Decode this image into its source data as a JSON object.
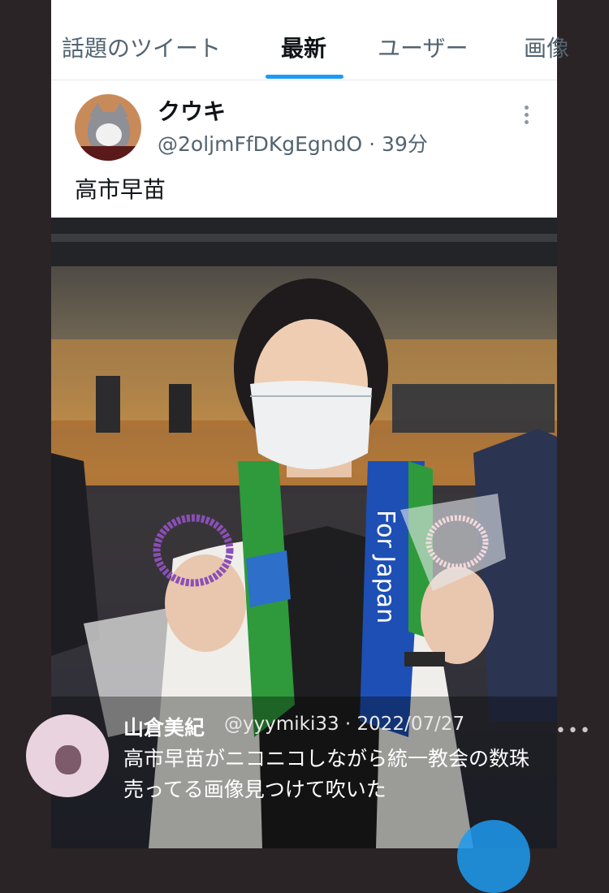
{
  "tabs": [
    {
      "label": "話題のツイート",
      "active": false
    },
    {
      "label": "最新",
      "active": true
    },
    {
      "label": "ユーザー",
      "active": false
    },
    {
      "label": "画像",
      "active": false
    }
  ],
  "tweet": {
    "author_name": "クウキ",
    "handle_time": "@2oljmFfDKgEgndO · 39分",
    "text": "高市早苗"
  },
  "quoted_tweet": {
    "author_name": "山倉美紀",
    "handle_date": "@yyymiki33 · 2022/07/27",
    "text_line1": "高市早苗がニコニコしながら統一教会の数珠",
    "text_line2": "売ってる画像見つけて吹いた"
  },
  "photo": {
    "towel_text": "For Japan"
  },
  "icons": [
    "more-vertical-icon",
    "more-horizontal-icon",
    "cat-avatar",
    "compose-fab"
  ],
  "colors": {
    "accent": "#1d9bf0",
    "text_primary": "#0f1419",
    "text_secondary": "#536471"
  }
}
